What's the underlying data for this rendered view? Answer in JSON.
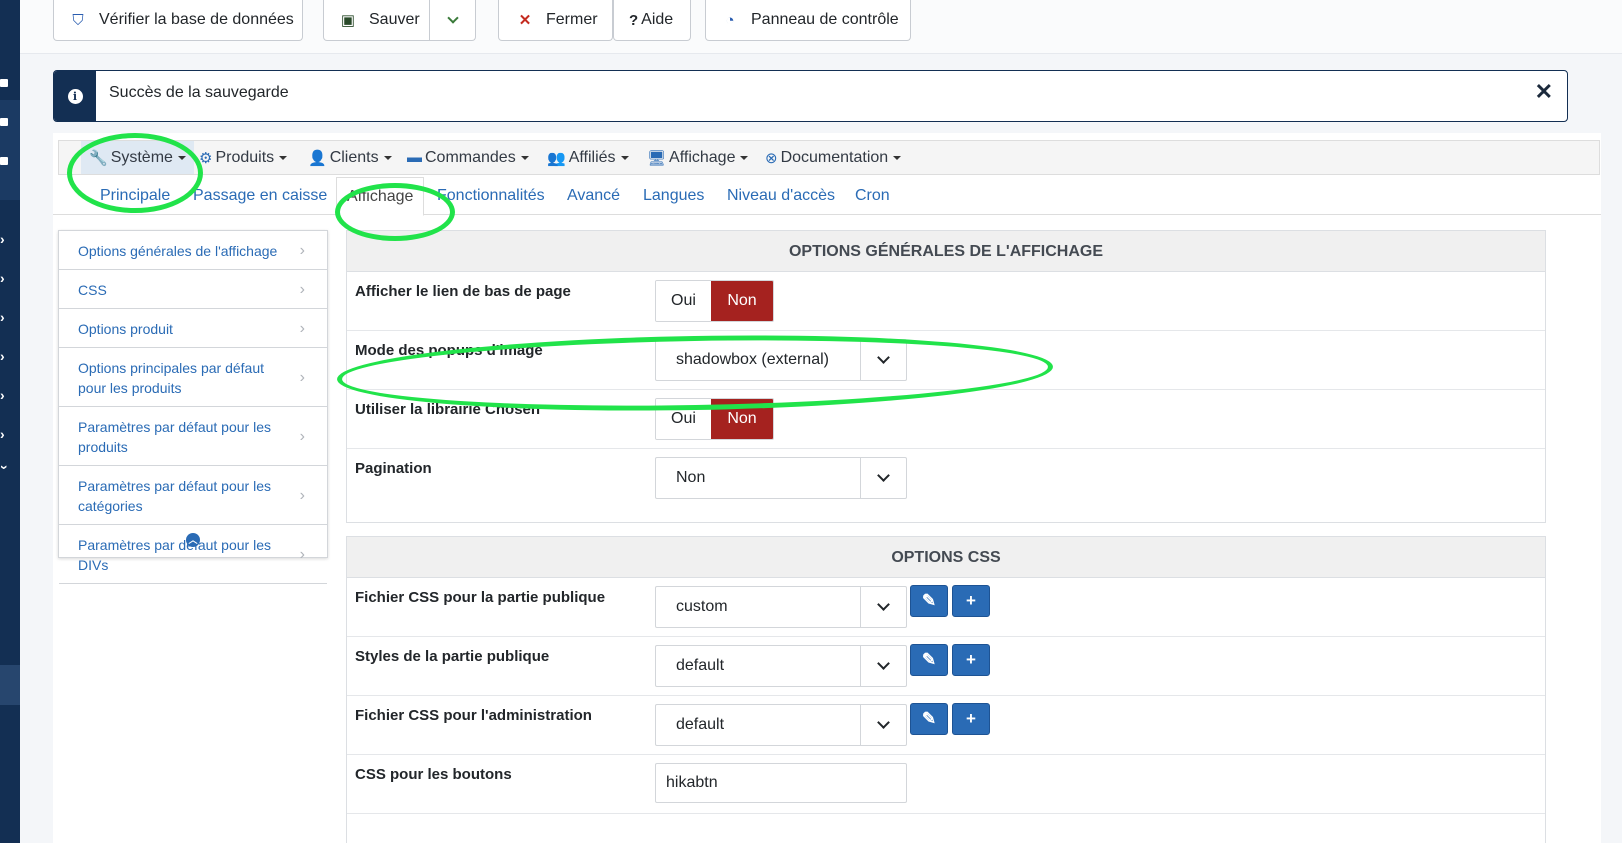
{
  "toolbar": {
    "verify_db": "Vérifier la base de données",
    "save": "Sauver",
    "close": "Fermer",
    "help": "Aide",
    "help_glyph": "?",
    "dashboard": "Panneau de contrôle"
  },
  "alert": {
    "message": "Succès de la sauvegarde",
    "close_glyph": "✕"
  },
  "menu": {
    "items": [
      {
        "label": "Système",
        "icon": "wrench-icon",
        "glyph": "🔧"
      },
      {
        "label": "Produits",
        "icon": "cubes-icon",
        "glyph": "⚙"
      },
      {
        "label": "Clients",
        "icon": "user-icon",
        "glyph": "👤"
      },
      {
        "label": "Commandes",
        "icon": "credit-card-icon",
        "glyph": "▬"
      },
      {
        "label": "Affiliés",
        "icon": "users-icon",
        "glyph": "👥"
      },
      {
        "label": "Affichage",
        "icon": "desktop-icon",
        "glyph": "🖥"
      },
      {
        "label": "Documentation",
        "icon": "life-ring-icon",
        "glyph": "⊗"
      }
    ]
  },
  "subtabs": [
    "Principale",
    "Passage en caisse",
    "Affichage",
    "Fonctionnalités",
    "Avancé",
    "Langues",
    "Niveau d'accès",
    "Cron"
  ],
  "nav": {
    "items": [
      "Options générales de l'affichage",
      "CSS",
      "Options produit",
      "Options principales par défaut pour les produits",
      "Paramètres par défaut pour les produits",
      "Paramètres par défaut pour les catégories",
      "Paramètres par défaut pour les DIVs"
    ]
  },
  "display_section": {
    "title": "OPTIONS GÉNÉRALES DE L'AFFICHAGE",
    "footer_link": {
      "label": "Afficher le lien de bas de page",
      "yes": "Oui",
      "no": "Non",
      "value": "Non"
    },
    "popup_mode": {
      "label": "Mode des popups d'image",
      "value": "shadowbox (external)"
    },
    "chosen": {
      "label": "Utiliser la librairie Chosen",
      "yes": "Oui",
      "no": "Non",
      "value": "Non"
    },
    "pagination": {
      "label": "Pagination",
      "value": "Non"
    }
  },
  "css_section": {
    "title": "OPTIONS CSS",
    "frontend_css": {
      "label": "Fichier CSS pour la partie publique",
      "value": "custom"
    },
    "frontend_styles": {
      "label": "Styles de la partie publique",
      "value": "default"
    },
    "backend_css": {
      "label": "Fichier CSS pour l'administration",
      "value": "default"
    },
    "buttons_css": {
      "label": "CSS pour les boutons",
      "value": "hikabtn"
    }
  },
  "colors": {
    "sidebar": "#132f53",
    "link": "#2a6bb5",
    "toggle_active": "#a5221f",
    "annotation": "#21e34a"
  }
}
